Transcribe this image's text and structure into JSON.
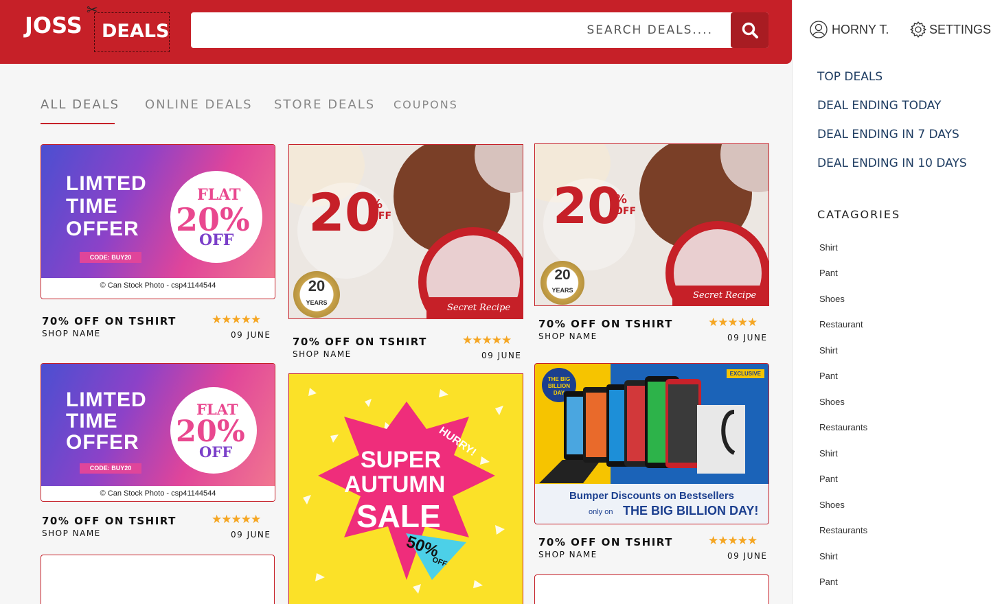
{
  "header": {
    "logo_left": "JOSS",
    "logo_right": "DEALS",
    "search_placeholder": "SEARCH DEALS....",
    "colors": {
      "brand_red": "#c62028",
      "dark_red": "#a81c22"
    }
  },
  "user": {
    "name": "HORNY T.",
    "settings_label": "SETTINGS"
  },
  "sidebar": {
    "deal_links": [
      "TOP DEALS",
      "DEAL ENDING TODAY",
      "DEAL ENDING IN 7 DAYS",
      "DEAL ENDING IN 10 DAYS"
    ],
    "categories_title": "CATAGORIES",
    "categories": [
      "Shirt",
      "Pant",
      "Shoes",
      "Restaurant",
      "Shirt",
      "Pant",
      "Shoes",
      "Restaurants",
      "Shirt",
      "Pant",
      "Shoes",
      "Restaurants",
      "Shirt",
      "Pant"
    ]
  },
  "tabs": [
    "ALL DEALS",
    "ONLINE DEALS",
    "STORE DEALS",
    "COUPONS"
  ],
  "active_tab": "ALL DEALS",
  "deals": [
    {
      "title": "70% OFF ON TSHIRT",
      "shop": "SHOP NAME",
      "date": "09 JUNE",
      "rating": 5
    },
    {
      "title": "70% OFF ON TSHIRT",
      "shop": "SHOP NAME",
      "date": "09 JUNE",
      "rating": 5
    },
    {
      "title": "70% OFF ON TSHIRT",
      "shop": "SHOP NAME",
      "date": "09 JUNE",
      "rating": 5
    },
    {
      "title": "70% OFF ON TSHIRT",
      "shop": "SHOP NAME",
      "date": "09 JUNE",
      "rating": 5
    },
    {
      "title": "70% OFF ON TSHIRT",
      "shop": "SHOP NAME",
      "date": "09 JUNE",
      "rating": 5
    }
  ],
  "banners": {
    "lto": {
      "line1": "LIMTED",
      "line2": "TIME",
      "line3": "OFFER",
      "flat": "FLAT",
      "percent": "20%",
      "off": "OFF",
      "code": "CODE: BUY20",
      "caption": "© Can Stock Photo - csp41144544"
    },
    "cake": {
      "big": "20",
      "pct": "%",
      "off": "OFF",
      "medal_num": "20",
      "medal_word": "YEARS",
      "brand": "Secret Recipe"
    },
    "autumn": {
      "hurry": "HURRY!",
      "line1": "SUPER",
      "line2": "AUTUMN",
      "line3": "SALE",
      "pct": "50%",
      "off": "OFF"
    },
    "bigbillion": {
      "badge": "THE BIG BILLION DAY",
      "line1": "Bumper Discounts on Bestsellers",
      "only_on": "only on",
      "line2": "THE BIG BILLION DAY!",
      "exclusive": "EXCLUSIVE"
    }
  }
}
